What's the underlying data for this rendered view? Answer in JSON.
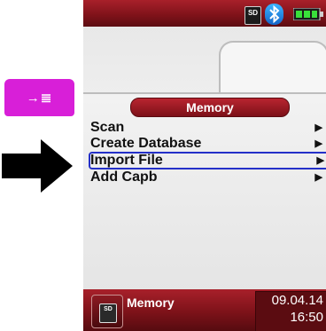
{
  "side_key": {
    "symbol": "→≣",
    "color": "#d81fd8"
  },
  "status_bar": {
    "sd_label": "SD",
    "icons": [
      "sd-card-icon",
      "bluetooth-icon",
      "battery-icon"
    ]
  },
  "menu": {
    "title": "Memory",
    "items": [
      {
        "label": "Scan",
        "arrow": "▶",
        "selected": false
      },
      {
        "label": "Create Database",
        "arrow": "▶",
        "selected": false
      },
      {
        "label": "Import File",
        "arrow": "▶",
        "selected": true
      },
      {
        "label": "Add Capb",
        "arrow": "▶",
        "selected": false
      }
    ]
  },
  "footer": {
    "label": "Memory",
    "icon_label": "SD",
    "date": "09.04.14",
    "time": "16:50"
  },
  "colors": {
    "brand_red": "#8c1820",
    "selection_blue": "#2430c8",
    "pointer": "#000000"
  }
}
